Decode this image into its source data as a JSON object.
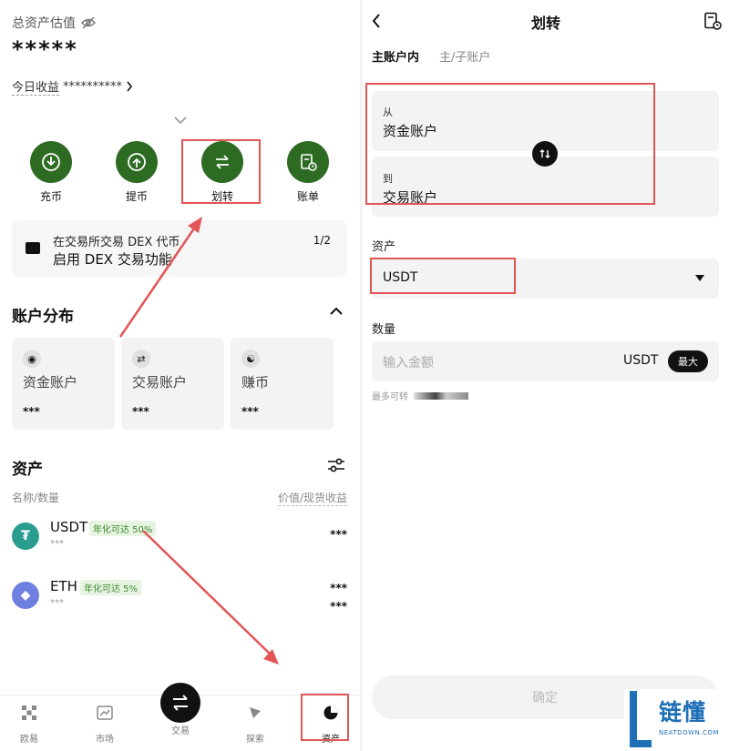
{
  "left": {
    "hero_label": "总资产估值",
    "hero_value": "*****",
    "today_label": "今日收益",
    "today_value": "**********",
    "actions": [
      {
        "label": "充币",
        "icon": "deposit-icon"
      },
      {
        "label": "提币",
        "icon": "withdraw-icon"
      },
      {
        "label": "划转",
        "icon": "transfer-icon"
      },
      {
        "label": "账单",
        "icon": "bill-icon"
      }
    ],
    "dex_banner": {
      "line1": "在交易所交易 DEX 代币",
      "line2": "启用 DEX 交易功能",
      "page": "1/2"
    },
    "distribution_title": "账户分布",
    "accounts": [
      {
        "name": "资金账户",
        "value": "***"
      },
      {
        "name": "交易账户",
        "value": "***"
      },
      {
        "name": "赚币",
        "value": "***"
      }
    ],
    "assets_title": "资产",
    "col_left": "名称/数量",
    "col_right": "价值/现货收益",
    "assets": [
      {
        "symbol": "USDT",
        "apy": "年化可达 50%",
        "amount": "***",
        "value": "***",
        "pnl": ""
      },
      {
        "symbol": "ETH",
        "apy": "年化可达 5%",
        "amount": "***",
        "value": "***",
        "pnl": "***"
      }
    ],
    "nav": [
      {
        "label": "欧易",
        "icon": "okx-logo-icon"
      },
      {
        "label": "市场",
        "icon": "market-chart-icon"
      },
      {
        "label": "交易",
        "icon": "trade-icon"
      },
      {
        "label": "探索",
        "icon": "explore-icon"
      },
      {
        "label": "资产",
        "icon": "assets-pie-icon"
      }
    ]
  },
  "right": {
    "title": "划转",
    "tabs": [
      "主账户内",
      "主/子账户"
    ],
    "from_label": "从",
    "from_value": "资金账户",
    "to_label": "到",
    "to_value": "交易账户",
    "asset_label": "资产",
    "asset_value": "USDT",
    "amount_label": "数量",
    "amount_placeholder": "输入金额",
    "amount_unit": "USDT",
    "max_label": "最大",
    "max_transfer": "最多可转",
    "confirm": "确定"
  },
  "watermark": {
    "title": "链懂",
    "sub": "NEATDOWN.COM"
  },
  "colors": {
    "green": "#2e6b22",
    "annotation_red": "#e25555",
    "tether": "#2a9d8f",
    "eth": "#6e7fe0"
  }
}
